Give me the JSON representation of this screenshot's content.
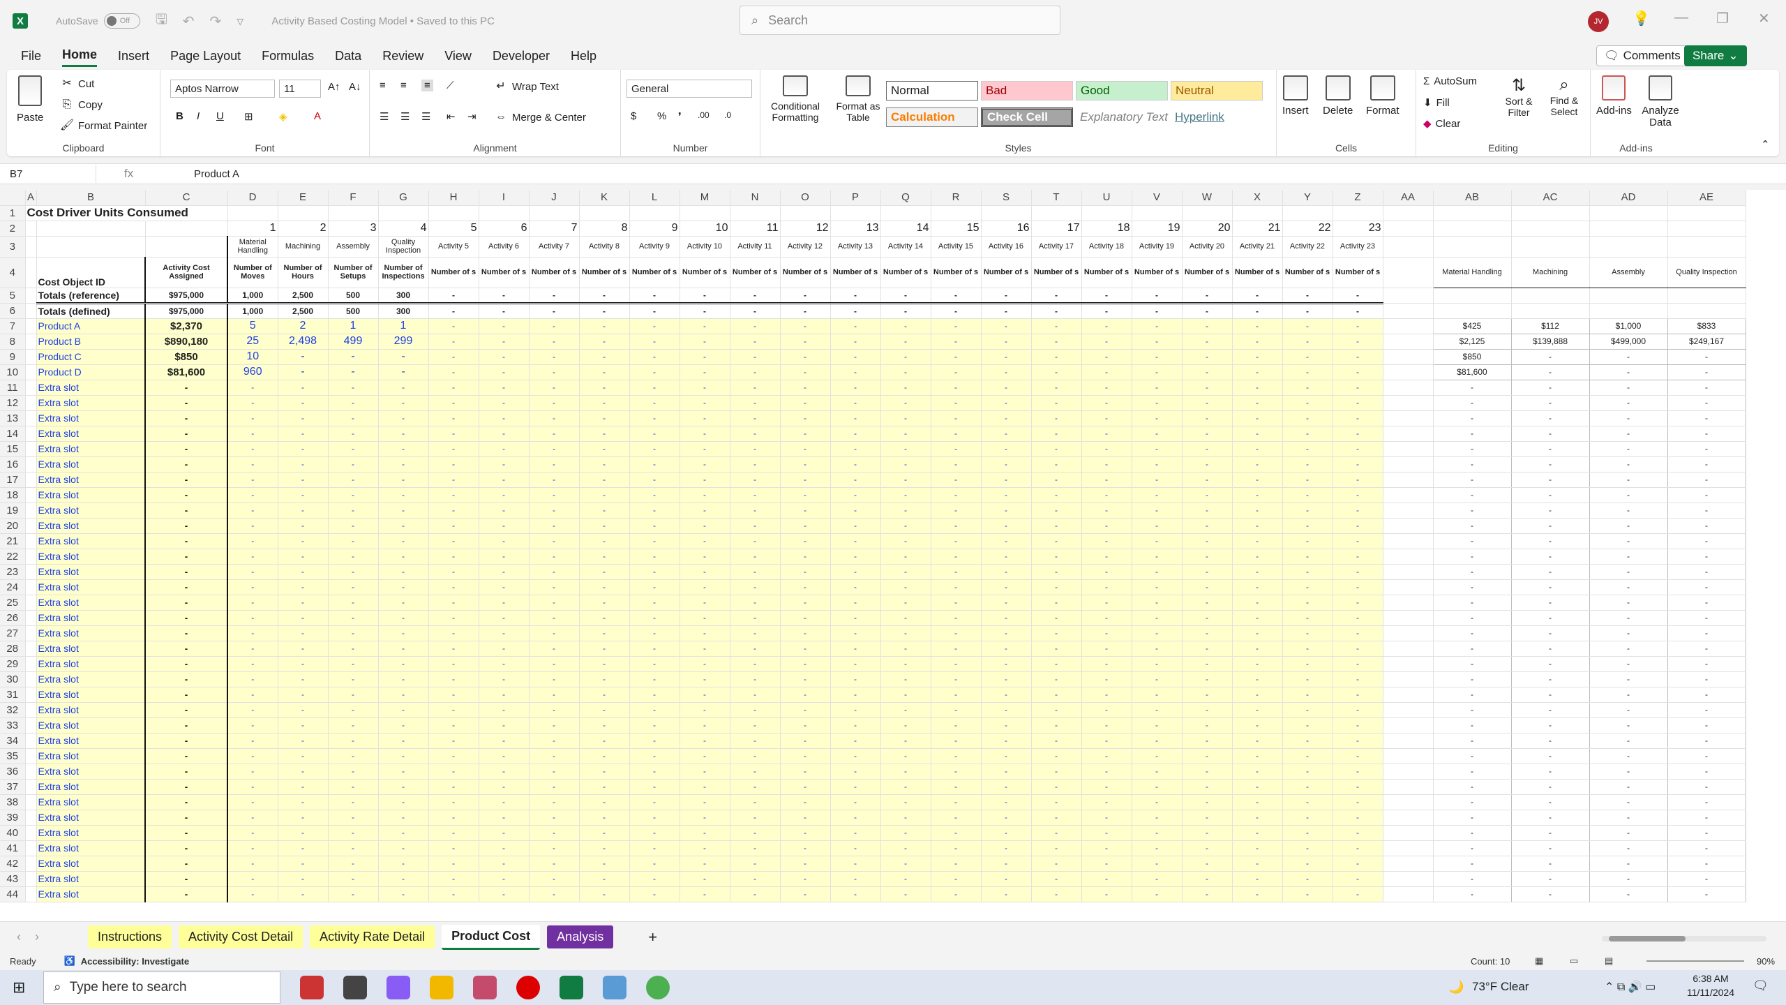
{
  "titlebar": {
    "autosave_label": "AutoSave",
    "autosave_state": "Off",
    "doc_title": "Activity Based Costing Model • Saved to this PC",
    "search_placeholder": "Search",
    "user_initials": "JV"
  },
  "menu": [
    "File",
    "Home",
    "Insert",
    "Page Layout",
    "Formulas",
    "Data",
    "Review",
    "View",
    "Developer",
    "Help"
  ],
  "menu_right": {
    "comments": "Comments",
    "share": "Share"
  },
  "ribbon": {
    "clipboard": {
      "paste": "Paste",
      "cut": "Cut",
      "copy": "Copy",
      "format_painter": "Format Painter",
      "label": "Clipboard"
    },
    "font": {
      "name": "Aptos Narrow",
      "size": "11",
      "label": "Font"
    },
    "alignment": {
      "wrap": "Wrap Text",
      "merge": "Merge & Center",
      "label": "Alignment"
    },
    "number": {
      "format": "General",
      "label": "Number"
    },
    "styles": {
      "conditional": "Conditional Formatting",
      "format_table": "Format as Table",
      "normal": "Normal",
      "bad": "Bad",
      "good": "Good",
      "neutral": "Neutral",
      "calculation": "Calculation",
      "check_cell": "Check Cell",
      "explanatory": "Explanatory Text",
      "hyperlink": "Hyperlink",
      "label": "Styles"
    },
    "cells": {
      "insert": "Insert",
      "delete": "Delete",
      "format": "Format",
      "label": "Cells"
    },
    "editing": {
      "autosum": "AutoSum",
      "fill": "Fill",
      "clear": "Clear",
      "sort": "Sort & Filter",
      "find": "Find & Select",
      "label": "Editing"
    },
    "addins": {
      "addins": "Add-ins",
      "analyze": "Analyze Data",
      "label": "Add-ins"
    }
  },
  "formula_bar": {
    "cell_ref": "B7",
    "fx": "fx",
    "content": "Product A"
  },
  "sheet": {
    "col_headers": [
      "A",
      "B",
      "C",
      "D",
      "E",
      "F",
      "G",
      "H",
      "I",
      "J",
      "K",
      "L",
      "M",
      "N",
      "O",
      "P",
      "Q",
      "R",
      "S",
      "T",
      "U",
      "V",
      "W",
      "X",
      "Y",
      "Z",
      "AA",
      "AB",
      "AC",
      "AD",
      "AE"
    ],
    "title": "Cost Driver Units Consumed",
    "activity_numbers": [
      "1",
      "2",
      "3",
      "4",
      "5",
      "6",
      "7",
      "8",
      "9",
      "10",
      "11",
      "12",
      "13",
      "14",
      "15",
      "16",
      "17",
      "18",
      "19",
      "20",
      "21",
      "22",
      "23"
    ],
    "activity_names": [
      "Material Handling",
      "Machining",
      "Assembly",
      "Quality Inspection",
      "Activity 5",
      "Activity 6",
      "Activity 7",
      "Activity 8",
      "Activity 9",
      "Activity 10",
      "Activity 11",
      "Activity 12",
      "Activity 13",
      "Activity 14",
      "Activity 15",
      "Activity 16",
      "Activity 17",
      "Activity 18",
      "Activity 19",
      "Activity 20",
      "Activity 21",
      "Activity 22",
      "Activity 23"
    ],
    "driver_names": [
      "Number of Moves",
      "Number of Hours",
      "Number of Setups",
      "Number of Inspections",
      "Number of s",
      "Number of s",
      "Number of s",
      "Number of s",
      "Number of s",
      "Number of s",
      "Number of s",
      "Number of s",
      "Number of s",
      "Number of s",
      "Number of s",
      "Number of s",
      "Number of s",
      "Number of s",
      "Number of s",
      "Number of s",
      "Number of s",
      "Number of s",
      "Number of s"
    ],
    "cost_object_header": "Cost Object ID",
    "activity_cost_header": "Activity Cost Assigned",
    "totals_reference": {
      "label": "Totals (reference)",
      "cost": "$975,000",
      "values": [
        "1,000",
        "2,500",
        "500",
        "300"
      ]
    },
    "totals_defined": {
      "label": "Totals (defined)",
      "cost": "$975,000",
      "values": [
        "1,000",
        "2,500",
        "500",
        "300"
      ]
    },
    "products": [
      {
        "name": "Product A",
        "cost": "$2,370",
        "values": [
          "5",
          "2",
          "1",
          "1"
        ]
      },
      {
        "name": "Product B",
        "cost": "$890,180",
        "values": [
          "25",
          "2,498",
          "499",
          "299"
        ]
      },
      {
        "name": "Product C",
        "cost": "$850",
        "values": [
          "10",
          "-",
          "-",
          "-"
        ]
      },
      {
        "name": "Product D",
        "cost": "$81,600",
        "values": [
          "960",
          "-",
          "-",
          "-"
        ]
      }
    ],
    "extra_slot_label": "Extra slot",
    "dash": "-",
    "right_headers": [
      "Material Handling",
      "Machining",
      "Assembly",
      "Quality Inspection"
    ],
    "right_values": [
      [
        "$425",
        "$112",
        "$1,000",
        "$833"
      ],
      [
        "$2,125",
        "$139,888",
        "$499,000",
        "$249,167"
      ],
      [
        "$850",
        "-",
        "-",
        "-"
      ],
      [
        "$81,600",
        "-",
        "-",
        "-"
      ]
    ]
  },
  "tabs": [
    "Instructions",
    "Activity Cost Detail",
    "Activity Rate Detail",
    "Product Cost",
    "Analysis"
  ],
  "status": {
    "ready": "Ready",
    "accessibility": "Accessibility: Investigate",
    "count": "Count: 10",
    "zoom": "90%"
  },
  "taskbar": {
    "search": "Type here to search",
    "weather": "73°F  Clear",
    "time": "6:38 AM",
    "date": "11/11/2024"
  }
}
